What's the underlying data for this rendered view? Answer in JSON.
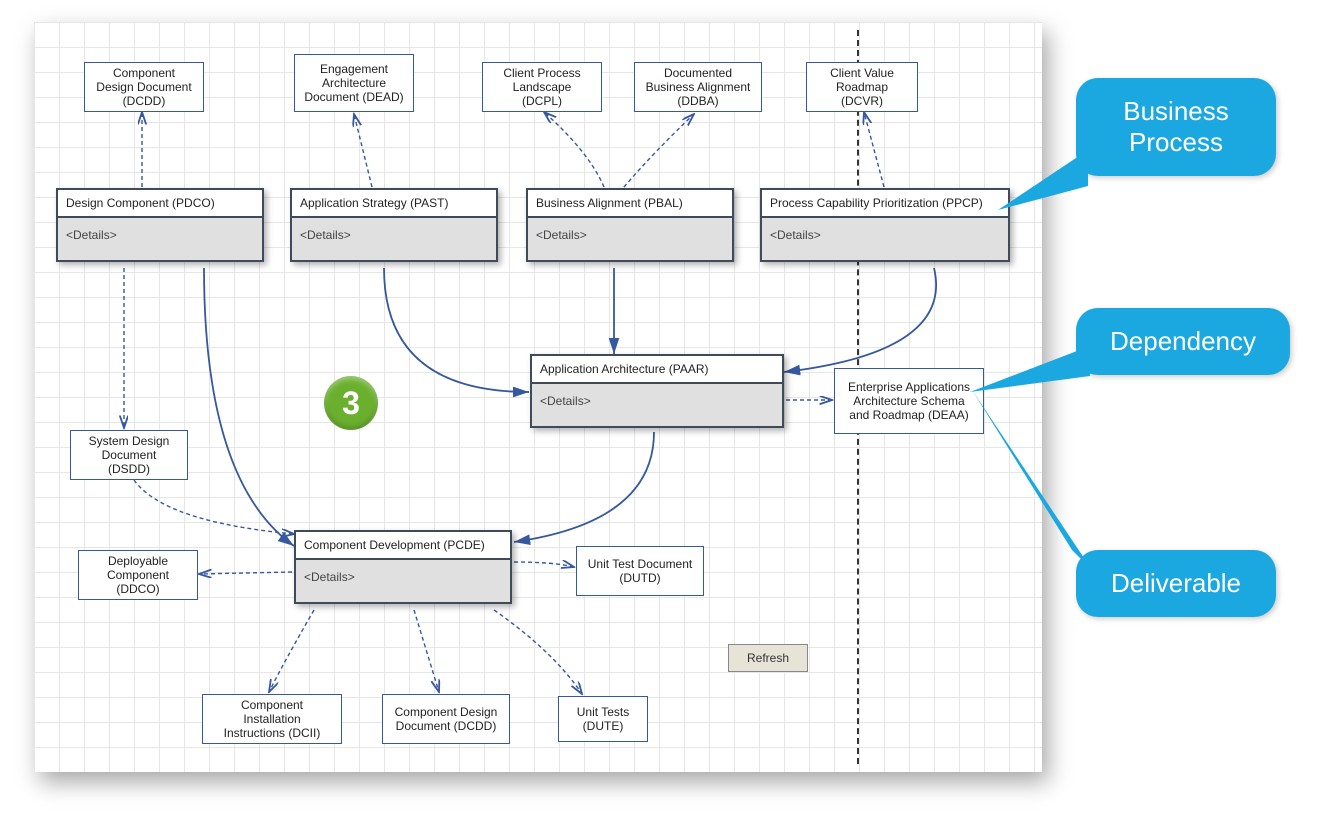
{
  "badge_number": "3",
  "refresh_label": "Refresh",
  "details_label": "<Details>",
  "processes": {
    "pdco": {
      "title": "Design Component (PDCO)"
    },
    "past": {
      "title": "Application Strategy (PAST)"
    },
    "pbal": {
      "title": "Business Alignment (PBAL)"
    },
    "ppcp": {
      "title": "Process Capability Prioritization (PPCP)"
    },
    "paar": {
      "title": "Application Architecture (PAAR)"
    },
    "pcde": {
      "title": "Component Development (PCDE)"
    }
  },
  "deliverables": {
    "dcdd_top": "Component Design Document (DCDD)",
    "dead": "Engagement Architecture Document (DEAD)",
    "dcpl": "Client Process Landscape (DCPL)",
    "ddba": "Documented Business Alignment (DDBA)",
    "dcvr": "Client Value Roadmap (DCVR)",
    "dsdd": "System Design Document (DSDD)",
    "deaa": "Enterprise Applications Architecture Schema and Roadmap (DEAA)",
    "ddco": "Deployable Component (DDCO)",
    "dutd": "Unit Test Document (DUTD)",
    "dcii": "Component Installation Instructions (DCII)",
    "dcdd_bot": "Component Design Document (DCDD)",
    "dute": "Unit Tests (DUTE)"
  },
  "callouts": {
    "business": "Business Process",
    "dependency": "Dependency",
    "deliverable": "Deliverable"
  }
}
